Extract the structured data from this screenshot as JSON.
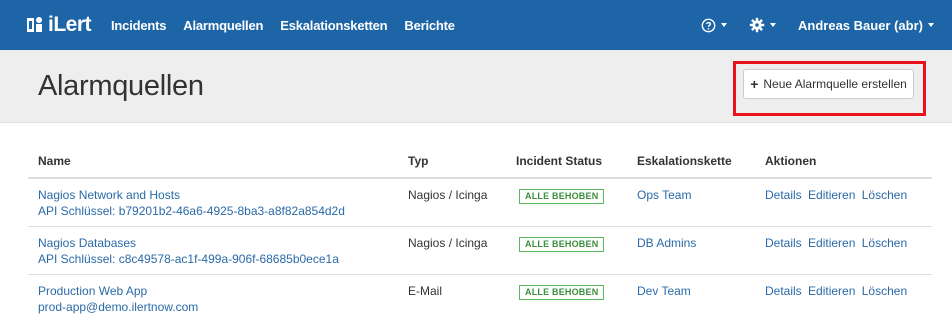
{
  "nav": {
    "brand": "iLert",
    "links": [
      "Incidents",
      "Alarmquellen",
      "Eskalationsketten",
      "Berichte"
    ],
    "help_icon": "help-circle-icon",
    "settings_icon": "gear-icon",
    "user": "Andreas Bauer (abr)"
  },
  "page": {
    "title": "Alarmquellen",
    "new_button": {
      "icon": "+",
      "label": "Neue Alarmquelle erstellen"
    }
  },
  "table": {
    "headers": [
      "Name",
      "Typ",
      "Incident Status",
      "Eskalationskette",
      "Aktionen"
    ],
    "rows": [
      {
        "name": "Nagios Network and Hosts",
        "detail": "API Schlüssel: b79201b2-46a6-4925-8ba3-a8f82a854d2d",
        "type": "Nagios / Icinga",
        "status": "ALLE BEHOBEN",
        "chain": "Ops Team",
        "actions": [
          "Details",
          "Editieren",
          "Löschen"
        ]
      },
      {
        "name": "Nagios Databases",
        "detail": "API Schlüssel: c8c49578-ac1f-499a-906f-68685b0ece1a",
        "type": "Nagios / Icinga",
        "status": "ALLE BEHOBEN",
        "chain": "DB Admins",
        "actions": [
          "Details",
          "Editieren",
          "Löschen"
        ]
      },
      {
        "name": "Production Web App",
        "detail": "prod-app@demo.ilertnow.com",
        "type": "E-Mail",
        "status": "ALLE BEHOBEN",
        "chain": "Dev Team",
        "actions": [
          "Details",
          "Editieren",
          "Löschen"
        ]
      }
    ]
  },
  "colors": {
    "navbar": "#1d65a6",
    "link": "#2a6aa8",
    "badge_green": "#5cb85c",
    "highlight_red": "#e8141c"
  }
}
